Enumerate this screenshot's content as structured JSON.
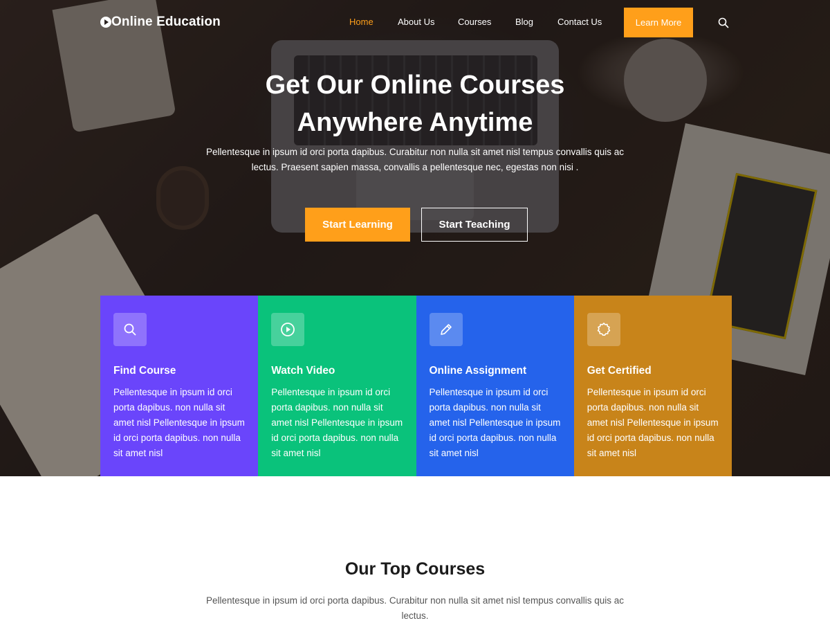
{
  "brand": {
    "name": "Online Education"
  },
  "nav": {
    "items": [
      {
        "label": "Home",
        "active": true
      },
      {
        "label": "About Us",
        "active": false
      },
      {
        "label": "Courses",
        "active": false
      },
      {
        "label": "Blog",
        "active": false
      },
      {
        "label": "Contact Us",
        "active": false
      }
    ],
    "cta_label": "Learn More",
    "search_icon": "search-icon"
  },
  "hero": {
    "title": "Get Our Online Courses Anywhere Anytime",
    "text": "Pellentesque in ipsum id orci porta dapibus. Curabitur non nulla sit amet nisl tempus convallis quis ac lectus. Praesent sapien massa, convallis a pellentesque nec, egestas non nisi .",
    "primary_button": "Start Learning",
    "secondary_button": "Start Teaching"
  },
  "features": [
    {
      "icon": "search-icon",
      "title": "Find Course",
      "text": "Pellentesque in ipsum id orci porta dapibus. non nulla sit amet nisl Pellentesque in ipsum id orci porta dapibus. non nulla sit amet nisl",
      "color": "#6a45fb"
    },
    {
      "icon": "play-icon",
      "title": "Watch Video",
      "text": "Pellentesque in ipsum id orci porta dapibus. non nulla sit amet nisl Pellentesque in ipsum id orci porta dapibus. non nulla sit amet nisl",
      "color": "#0ac27b"
    },
    {
      "icon": "pencil-icon",
      "title": "Online Assignment",
      "text": "Pellentesque in ipsum id orci porta dapibus. non nulla sit amet nisl Pellentesque in ipsum id orci porta dapibus. non nulla sit amet nisl",
      "color": "#2563eb"
    },
    {
      "icon": "badge-icon",
      "title": "Get Certified",
      "text": "Pellentesque in ipsum id orci porta dapibus. non nulla sit amet nisl Pellentesque in ipsum id orci porta dapibus. non nulla sit amet nisl",
      "color": "#c8841a"
    }
  ],
  "top_courses": {
    "heading": "Our Top Courses",
    "text": "Pellentesque in ipsum id orci porta dapibus. Curabitur non nulla sit amet nisl tempus convallis quis ac lectus."
  },
  "colors": {
    "accent": "#ff9f1a"
  }
}
